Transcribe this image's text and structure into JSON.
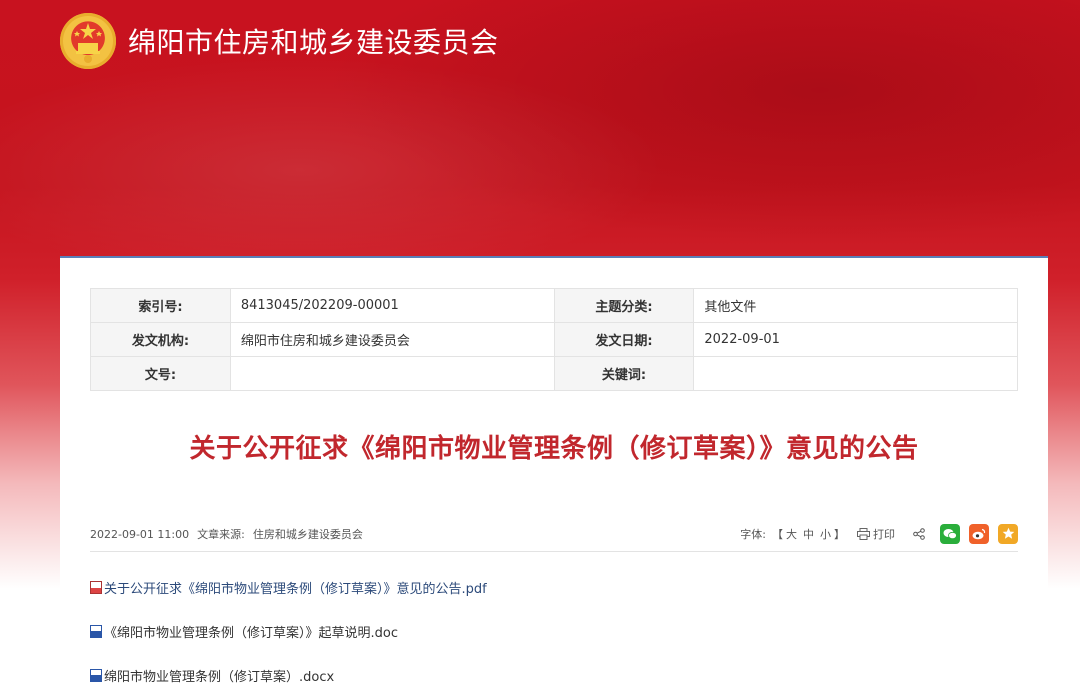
{
  "header": {
    "site_title": "绵阳市住房和城乡建设委员会"
  },
  "meta": {
    "rows": [
      {
        "k1": "索引号:",
        "v1": "8413045/202209-00001",
        "k2": "主题分类:",
        "v2": "其他文件"
      },
      {
        "k1": "发文机构:",
        "v1": "绵阳市住房和城乡建设委员会",
        "k2": "发文日期:",
        "v2": "2022-09-01"
      },
      {
        "k1": "文号:",
        "v1": "",
        "k2": "关键词:",
        "v2": ""
      }
    ]
  },
  "article": {
    "title": "关于公开征求《绵阳市物业管理条例（修订草案）》意见的公告",
    "datetime": "2022-09-01 11:00",
    "source_label": "文章来源:",
    "source": "住房和城乡建设委员会"
  },
  "tools": {
    "font_label": "字体:",
    "bracket_open": "【",
    "size_large": "大",
    "size_medium": "中",
    "size_small": "小",
    "bracket_close": "】",
    "print_label": "打印"
  },
  "attachments": [
    {
      "name": "关于公开征求《绵阳市物业管理条例（修订草案）》意见的公告.pdf",
      "type": "pdf"
    },
    {
      "name": "《绵阳市物业管理条例（修订草案）》起草说明.doc",
      "type": "doc"
    },
    {
      "name": "绵阳市物业管理条例（修订草案）.docx",
      "type": "doc"
    }
  ],
  "colors": {
    "banner_red": "#c8121f",
    "title_red": "#c1272d",
    "panel_border": "#5a7fb8",
    "wechat": "#2aae3b",
    "weibo": "#f0612a",
    "favorite": "#f1a826"
  },
  "icons": [
    "national-emblem-icon",
    "print-icon",
    "share-icon",
    "wechat-icon",
    "weibo-icon",
    "favorite-star-icon",
    "pdf-file-icon",
    "word-file-icon"
  ]
}
